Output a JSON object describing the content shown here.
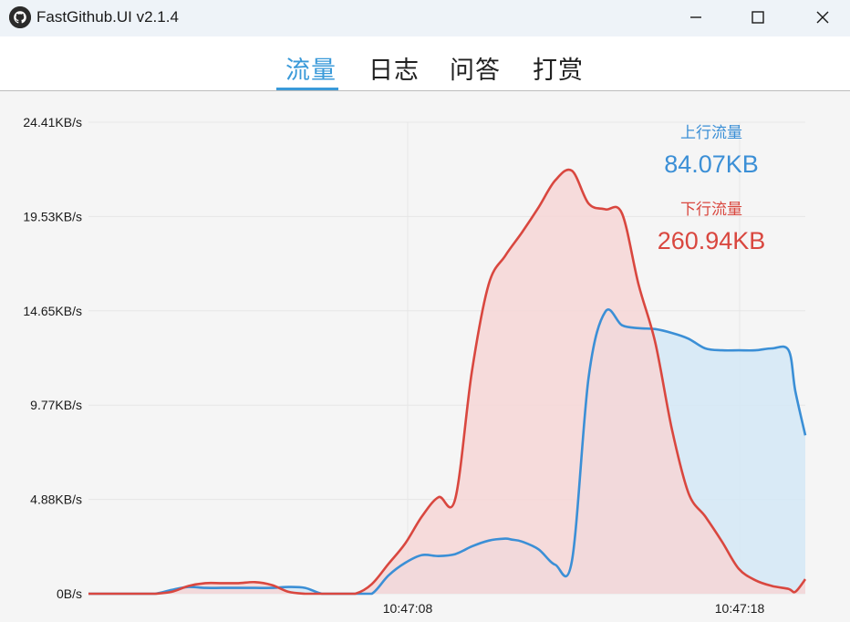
{
  "window": {
    "title": "FastGithub.UI v2.1.4",
    "icons": [
      "github-icon",
      "minimize-icon",
      "maximize-icon",
      "close-icon"
    ]
  },
  "tabs": [
    {
      "label": "流量",
      "active": true
    },
    {
      "label": "日志",
      "active": false
    },
    {
      "label": "问答",
      "active": false
    },
    {
      "label": "打赏",
      "active": false
    }
  ],
  "legend": {
    "upload_label": "上行流量",
    "upload_value": "84.07KB",
    "download_label": "下行流量",
    "download_value": "260.94KB"
  },
  "colors": {
    "accent": "#3a9ad9",
    "upload": "#3b8fd6",
    "upload_fill": "#d4e7f6",
    "download": "#d9473f",
    "download_fill": "#f6d6d6"
  },
  "chart_data": {
    "type": "area",
    "yunit": "KB/s",
    "ylim": [
      0,
      24.41
    ],
    "yticks": [
      "0B/s",
      "4.88KB/s",
      "9.77KB/s",
      "14.65KB/s",
      "19.53KB/s",
      "24.41KB/s"
    ],
    "xlabels": [
      "10:47:08",
      "10:47:18"
    ],
    "grid": true,
    "legend_position": "top-right",
    "series": [
      {
        "name": "上行流量",
        "color": "#3b8fd6",
        "x": [
          0,
          0.5,
          1,
          1.5,
          2,
          2.5,
          3,
          3.5,
          4,
          4.5,
          5,
          5.5,
          6,
          6.5,
          7,
          7.5,
          8,
          8.5,
          9,
          9.5,
          10,
          10.5,
          11,
          11.5,
          12,
          12.5,
          12.7,
          13,
          13.5,
          14,
          14.5,
          15,
          15.5,
          16,
          16.5,
          17,
          17.5,
          18,
          18.5,
          19,
          19.5,
          20,
          20.5,
          21,
          21.2,
          21.5
        ],
        "y": [
          0,
          0,
          0,
          0,
          0,
          0.2,
          0.35,
          0.3,
          0.3,
          0.3,
          0.3,
          0.3,
          0.35,
          0.3,
          0,
          0,
          0,
          0,
          0.95,
          1.6,
          2.0,
          1.95,
          2.05,
          2.45,
          2.75,
          2.85,
          2.8,
          2.7,
          2.3,
          1.5,
          1.7,
          11.2,
          14.6,
          13.9,
          13.75,
          13.7,
          13.5,
          13.2,
          12.7,
          12.6,
          12.6,
          12.6,
          12.7,
          12.6,
          10.5,
          8.2
        ],
        "total": "84.07KB"
      },
      {
        "name": "下行流量",
        "color": "#d9473f",
        "x": [
          0,
          0.5,
          1,
          1.5,
          2,
          2.5,
          3,
          3.5,
          4,
          4.5,
          5,
          5.5,
          6,
          6.5,
          7,
          7.5,
          8,
          8.5,
          9,
          9.5,
          10,
          10.5,
          11,
          11.5,
          12,
          12.5,
          13,
          13.5,
          14,
          14.5,
          15,
          15.5,
          16,
          16.5,
          17,
          17.5,
          18,
          18.5,
          19,
          19.5,
          20,
          20.5,
          21,
          21.2,
          21.5
        ],
        "y": [
          0,
          0,
          0,
          0,
          0,
          0.1,
          0.4,
          0.55,
          0.55,
          0.55,
          0.6,
          0.45,
          0.1,
          0,
          0,
          0,
          0,
          0.5,
          1.55,
          2.6,
          4.0,
          5.0,
          4.9,
          11.5,
          16.0,
          17.5,
          18.7,
          20.0,
          21.4,
          21.9,
          20.2,
          19.9,
          19.7,
          16.0,
          13.0,
          8.5,
          5.2,
          4.0,
          2.7,
          1.3,
          0.7,
          0.4,
          0.25,
          0.1,
          0.75
        ],
        "total": "260.94KB"
      }
    ]
  }
}
